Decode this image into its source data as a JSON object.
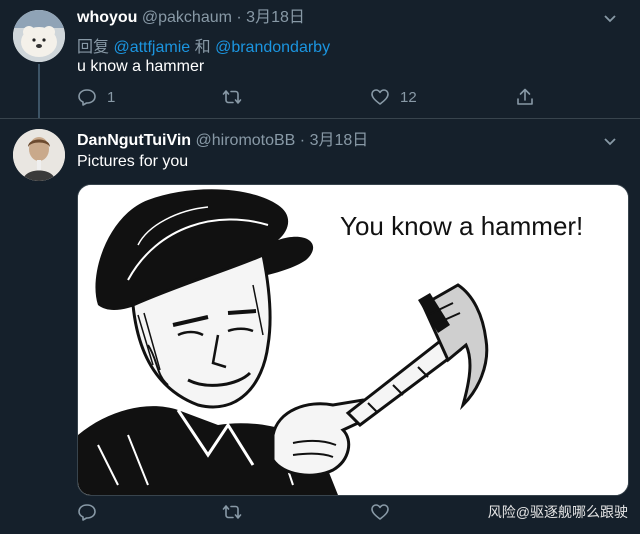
{
  "tweets": [
    {
      "name": "whoyou",
      "handle": "@pakchaum",
      "date": "3月18日",
      "reply_prefix": "回复 ",
      "reply_to_1": "@attfjamie",
      "reply_joiner": " 和 ",
      "reply_to_2": "@brandondarby",
      "text": "u know a hammer",
      "reply_count": "1",
      "like_count": "12"
    },
    {
      "name": "DanNgutTuiVin",
      "handle": "@hiromotoBB",
      "date": "3月18日",
      "text": "Pictures for you",
      "media_caption": "You know a hammer!"
    }
  ],
  "separator": " · ",
  "watermark": "风险@驱逐舰哪么跟驶",
  "icons": [
    "reply-icon",
    "retweet-icon",
    "like-icon",
    "share-icon",
    "caret-down-icon"
  ],
  "colors": {
    "background": "#15202b",
    "text": "#ffffff",
    "secondary": "#8899a6",
    "link": "#1b95e0",
    "border": "#38444d"
  }
}
